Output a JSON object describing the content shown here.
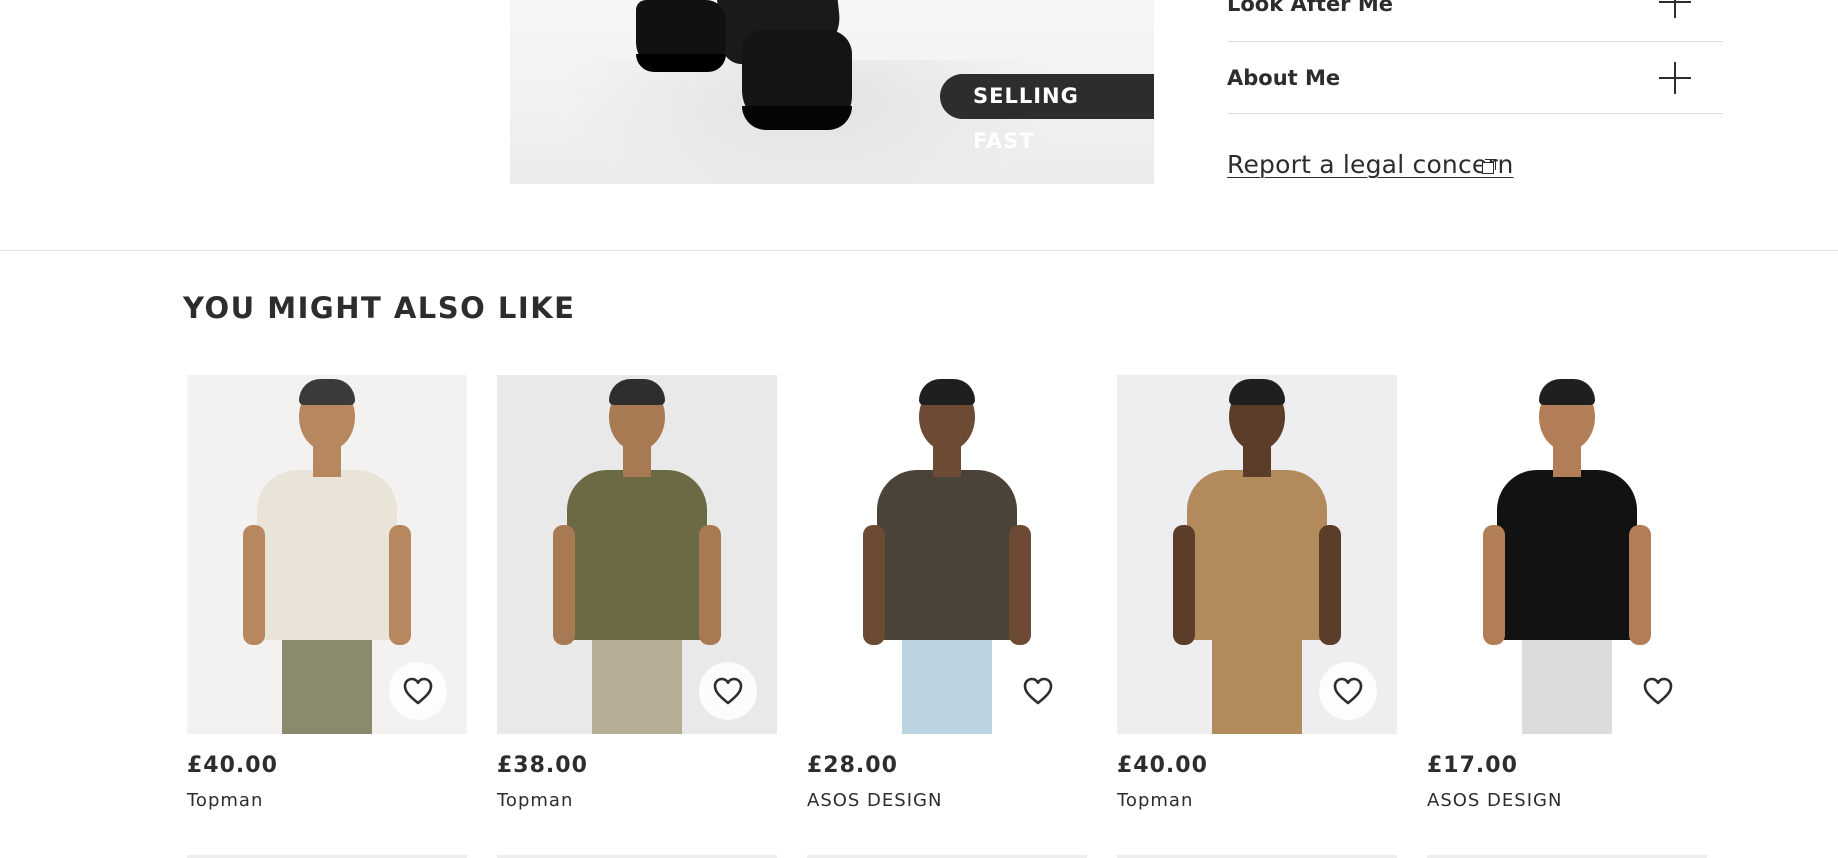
{
  "product": {
    "badge": "SELLING FAST"
  },
  "accordion": {
    "items": [
      {
        "label": "Look After Me",
        "icon": "plus-icon"
      },
      {
        "label": "About Me",
        "icon": "plus-icon"
      }
    ]
  },
  "legal": {
    "link_text": "Report a legal concern",
    "icon": "external-link-icon"
  },
  "recommendations": {
    "title": "YOU MIGHT ALSO LIKE",
    "items": [
      {
        "price": "£40.00",
        "brand": "Topman",
        "icon": "heart-icon",
        "colors": {
          "bg": "#f3f2f1",
          "top": "#e9e3d8",
          "bottom": "#8c8a6e",
          "skin": "#b7875f",
          "hair": "#3a3a3a"
        }
      },
      {
        "price": "£38.00",
        "brand": "Topman",
        "icon": "heart-icon",
        "colors": {
          "bg": "#e9e9ea",
          "top": "#6c6a45",
          "bottom": "#b5ad96",
          "skin": "#a87a54",
          "hair": "#2e2e2e"
        }
      },
      {
        "price": "£28.00",
        "brand": "ASOS DESIGN",
        "icon": "heart-icon",
        "colors": {
          "bg": "#ffffff",
          "top": "#4b4238",
          "bottom": "#bcd3e2",
          "skin": "#6d4a33",
          "hair": "#1f1f1f"
        }
      },
      {
        "price": "£40.00",
        "brand": "Topman",
        "icon": "heart-icon",
        "colors": {
          "bg": "#eeedef",
          "top": "#b28a5c",
          "bottom": "#b28a5c",
          "skin": "#5c3d2a",
          "hair": "#1f1f1f"
        }
      },
      {
        "price": "£17.00",
        "brand": "ASOS DESIGN",
        "icon": "heart-icon",
        "colors": {
          "bg": "#ffffff",
          "top": "#121212",
          "bottom": "#dcdcdc",
          "skin": "#b27e58",
          "hair": "#1f1f1f"
        }
      }
    ]
  }
}
